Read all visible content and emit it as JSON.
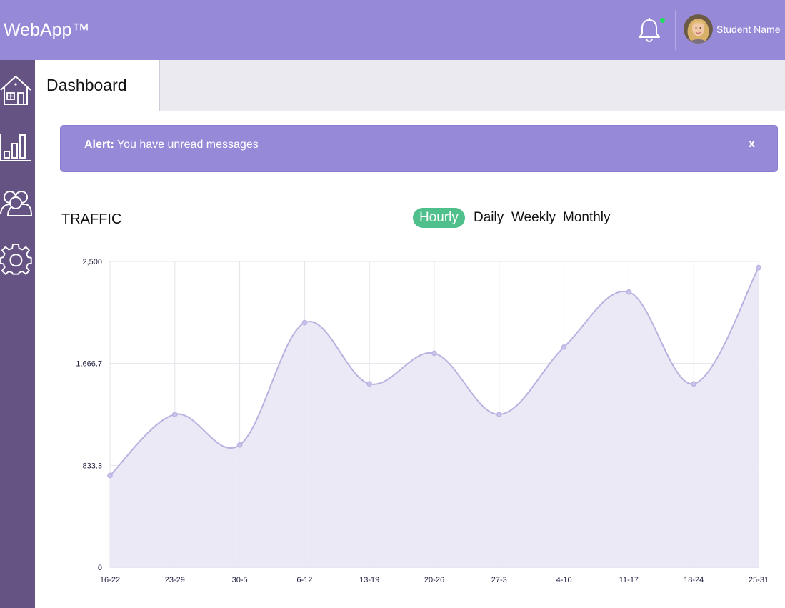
{
  "app": {
    "title": "WebApp™"
  },
  "header": {
    "notification_icon": "bell-icon",
    "notification_status_color": "#1ee05a",
    "user_name": "Student Name"
  },
  "sidebar": {
    "items": [
      {
        "icon": "home-icon"
      },
      {
        "icon": "bar-chart-icon"
      },
      {
        "icon": "users-icon"
      },
      {
        "icon": "gear-icon"
      }
    ]
  },
  "tabs": {
    "active_label": "Dashboard"
  },
  "alert": {
    "label": "Alert:",
    "message": " You have unread messages",
    "close_label": "x"
  },
  "traffic": {
    "title": "TRAFFIC",
    "ranges": [
      "Hourly",
      "Daily",
      "Weekly",
      "Monthly"
    ],
    "active_range": "Hourly"
  },
  "colors": {
    "header": "#9589d8",
    "sidebar": "#655384",
    "accent_green": "#4fbf8b",
    "chart_line": "#b9b1e0",
    "chart_fill": "#e9e7f4"
  },
  "chart_data": {
    "type": "area",
    "categories": [
      "16-22",
      "23-29",
      "30-5",
      "6-12",
      "13-19",
      "20-26",
      "27-3",
      "4-10",
      "11-17",
      "18-24",
      "25-31"
    ],
    "values": [
      750,
      1250,
      1000,
      2000,
      1500,
      1750,
      1250,
      1800,
      2250,
      1500,
      2450
    ],
    "ylim": [
      0,
      2500
    ],
    "yticks": [
      "0",
      "833.3",
      "1,666.7",
      "2,500"
    ],
    "grid": true,
    "title": "",
    "xlabel": "",
    "ylabel": ""
  }
}
